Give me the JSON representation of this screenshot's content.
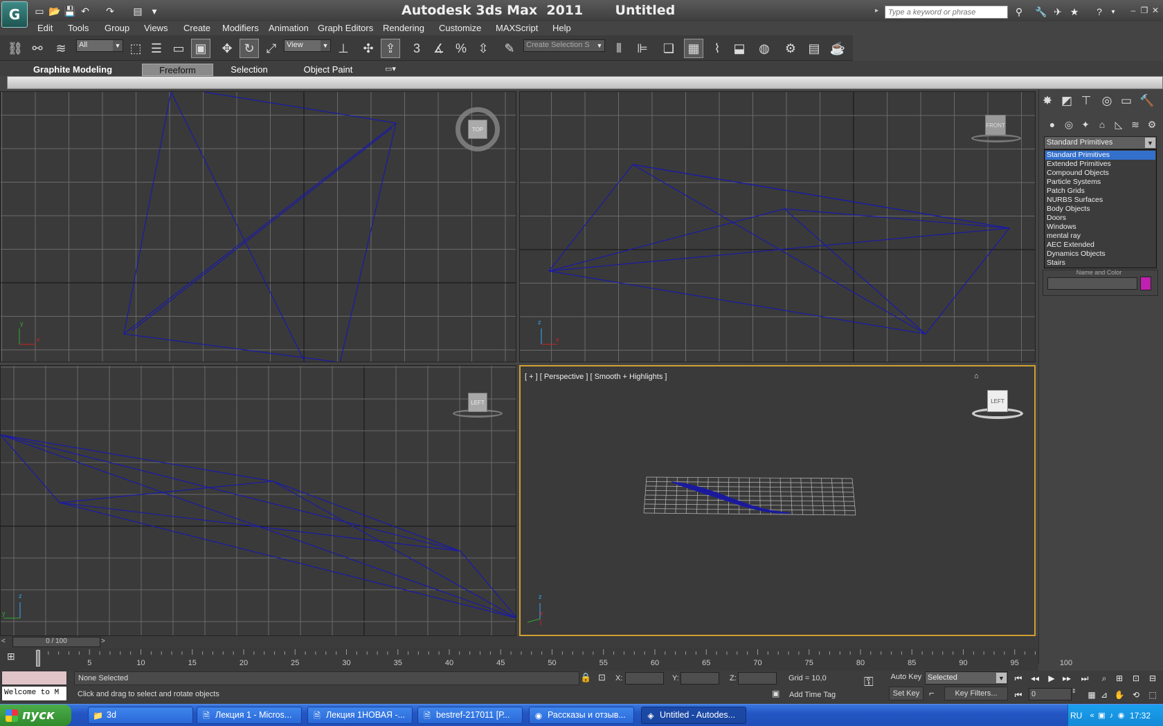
{
  "app": {
    "logo_glyph": "G",
    "title": "Autodesk 3ds Max  2011       Untitled",
    "search_placeholder": "Type a keyword or phrase"
  },
  "menu": [
    "Edit",
    "Tools",
    "Group",
    "Views",
    "Create",
    "Modifiers",
    "Animation",
    "Graph Editors",
    "Rendering",
    "Customize",
    "MAXScript",
    "Help"
  ],
  "toolbar": {
    "selection_filter": "All",
    "ref_coord": "View",
    "named_selection": "Create Selection S",
    "snap_label": "3"
  },
  "ribbon": {
    "title": "Graphite Modeling Tools",
    "tabs": [
      "Freeform",
      "Selection",
      "Object Paint"
    ],
    "active_tab": "Freeform"
  },
  "viewports": {
    "top": {
      "cube_label": "TOP",
      "axis_v": "y",
      "axis_h": "x"
    },
    "front": {
      "cube_label": "FRONT",
      "axis_v": "z",
      "axis_h": "x"
    },
    "left": {
      "cube_label": "LEFT",
      "axis_v": "z",
      "axis_h": "y"
    },
    "perspective": {
      "label": "[ + ] [ Perspective ] [ Smooth + Highlights ]",
      "cube_label": "LEFT",
      "axis_v": "z",
      "axis_h": "x"
    }
  },
  "command_panel": {
    "category": "Standard Primitives",
    "options": [
      "Standard Primitives",
      "Extended Primitives",
      "Compound Objects",
      "Particle Systems",
      "Patch Grids",
      "NURBS Surfaces",
      "Body Objects",
      "Doors",
      "Windows",
      "mental ray",
      "AEC Extended",
      "Dynamics Objects",
      "Stairs"
    ],
    "selected_index": 0,
    "rollout_name_and_color": "Name and Color",
    "object_color": "#c020b0"
  },
  "time_slider": {
    "label": "0 / 100",
    "ticks": [
      5,
      10,
      15,
      20,
      25,
      30,
      35,
      40,
      45,
      50,
      55,
      60,
      65,
      70,
      75,
      80,
      85,
      90,
      95,
      100
    ]
  },
  "status": {
    "maxscript_output": "Welcome to M",
    "selection": "None Selected",
    "prompt": "Click and drag to select and rotate objects",
    "x_label": "X:",
    "y_label": "Y:",
    "z_label": "Z:",
    "grid": "Grid = 10,0",
    "add_time_tag": "Add Time Tag",
    "auto_key": "Auto Key",
    "set_key": "Set Key",
    "key_filters": "Key Filters...",
    "key_mode": "Selected",
    "current_frame": "0"
  },
  "taskbar": {
    "start": "пуск",
    "tasks": [
      {
        "label": "3d",
        "icon": "folder-icon"
      },
      {
        "label": "Лекция 1 - Micros...",
        "icon": "word-doc-icon"
      },
      {
        "label": "Лекция 1НОВАЯ -...",
        "icon": "word-doc-icon"
      },
      {
        "label": "bestref-217011 [Р...",
        "icon": "word-doc-icon"
      },
      {
        "label": "Рассказы и отзыв...",
        "icon": "firefox-icon"
      },
      {
        "label": "Untitled - Autodes...",
        "icon": "3dsmax-icon"
      }
    ],
    "active_task": 5,
    "language": "RU",
    "clock": "17:32"
  },
  "colors": {
    "wire_blue": "#1a1aa8",
    "grid": "#6a6a6a",
    "grid_axis": "#111111",
    "viewport_bg": "#3a3a3a",
    "active_border": "#d0a030",
    "taskbar_blue": "#245edb"
  }
}
